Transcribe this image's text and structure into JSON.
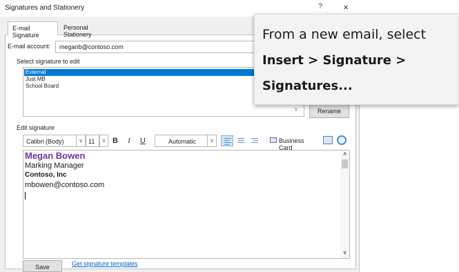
{
  "window": {
    "title": "Signatures and Stationery",
    "help_label": "?",
    "close_label": "×"
  },
  "tabs": [
    {
      "label": "E-mail Signature",
      "selected": true
    },
    {
      "label": "Personal Stationery",
      "selected": false
    }
  ],
  "account": {
    "label": "E-mail account:",
    "value": "meganb@contoso.com"
  },
  "select_signature": {
    "label": "Select signature to edit",
    "items": [
      "External",
      "Just MB",
      "School Board"
    ],
    "selected_index": 0,
    "rename_label": "Rename"
  },
  "edit_signature": {
    "label": "Edit signature",
    "font": "Calibri (Body)",
    "size": "11",
    "bold_label": "B",
    "italic_label": "I",
    "underline_label": "U",
    "color": "Automatic",
    "business_card_label": "Business Card"
  },
  "signature_content": {
    "name": "Megan Bowen",
    "title": "Marking Manager",
    "company": "Contoso, Inc",
    "email": "mbowen@contoso.com",
    "name_color": "#7030a0"
  },
  "bottom": {
    "save_label": "Save",
    "templates_link": "Get signature templates"
  },
  "callout": {
    "line1": "From a new email, select",
    "line2": "Insert > Signature >",
    "line3": "Signatures..."
  },
  "colors": {
    "selection": "#0078d7",
    "link": "#0563c1"
  }
}
